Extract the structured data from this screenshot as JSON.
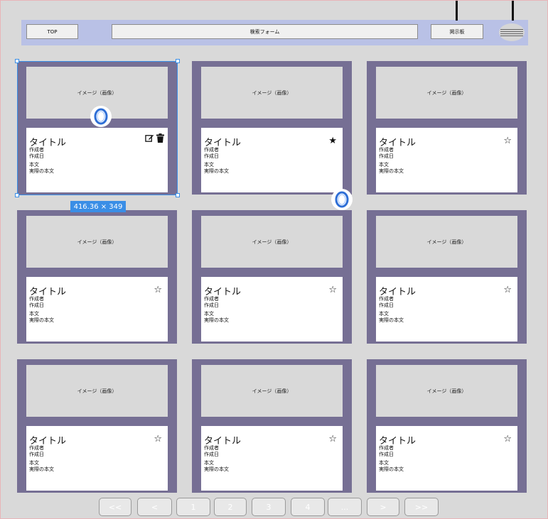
{
  "header": {
    "top_label": "TOP",
    "search_label": "検索フォーム",
    "board_label": "掲示板"
  },
  "cards": [
    {
      "image_text": "イメージ（画像）",
      "title": "タイトル",
      "author": "作成者",
      "date": "作成日",
      "body_label": "本文",
      "body_text": "実際の本文",
      "starred": null,
      "editable": true
    },
    {
      "image_text": "イメージ（画像）",
      "title": "タイトル",
      "author": "作成者",
      "date": "作成日",
      "body_label": "本文",
      "body_text": "実際の本文",
      "starred": true,
      "editable": false
    },
    {
      "image_text": "イメージ（画像）",
      "title": "タイトル",
      "author": "作成者",
      "date": "作成日",
      "body_label": "本文",
      "body_text": "実際の本文",
      "starred": false,
      "editable": false
    },
    {
      "image_text": "イメージ（画像）",
      "title": "タイトル",
      "author": "作成者",
      "date": "作成日",
      "body_label": "本文",
      "body_text": "実際の本文",
      "starred": false,
      "editable": false
    },
    {
      "image_text": "イメージ（画像）",
      "title": "タイトル",
      "author": "作成者",
      "date": "作成日",
      "body_label": "本文",
      "body_text": "実際の本文",
      "starred": false,
      "editable": false
    },
    {
      "image_text": "イメージ（画像）",
      "title": "タイトル",
      "author": "作成者",
      "date": "作成日",
      "body_label": "本文",
      "body_text": "実際の本文",
      "starred": false,
      "editable": false
    },
    {
      "image_text": "イメージ（画像）",
      "title": "タイトル",
      "author": "作成者",
      "date": "作成日",
      "body_label": "本文",
      "body_text": "実際の本文",
      "starred": false,
      "editable": false
    },
    {
      "image_text": "イメージ（画像）",
      "title": "タイトル",
      "author": "作成者",
      "date": "作成日",
      "body_label": "本文",
      "body_text": "実際の本文",
      "starred": false,
      "editable": false
    },
    {
      "image_text": "イメージ（画像）",
      "title": "タイトル",
      "author": "作成者",
      "date": "作成日",
      "body_label": "本文",
      "body_text": "実際の本文",
      "starred": false,
      "editable": false
    }
  ],
  "selection": {
    "dimensions_label": "416.36 × 349"
  },
  "badges": {
    "letter": "O"
  },
  "pagination": [
    "<<",
    "<",
    "1",
    "2",
    "3",
    "4",
    "...",
    ">",
    ">>"
  ],
  "icons": {
    "star_filled": "★",
    "star_empty": "☆",
    "edit": "edit-icon",
    "trash": "trash-icon",
    "menu": "hamburger-menu-icon"
  },
  "colors": {
    "card_frame": "#766f94",
    "header_bg": "#b9c1e6",
    "selection": "#3a8ee6"
  }
}
